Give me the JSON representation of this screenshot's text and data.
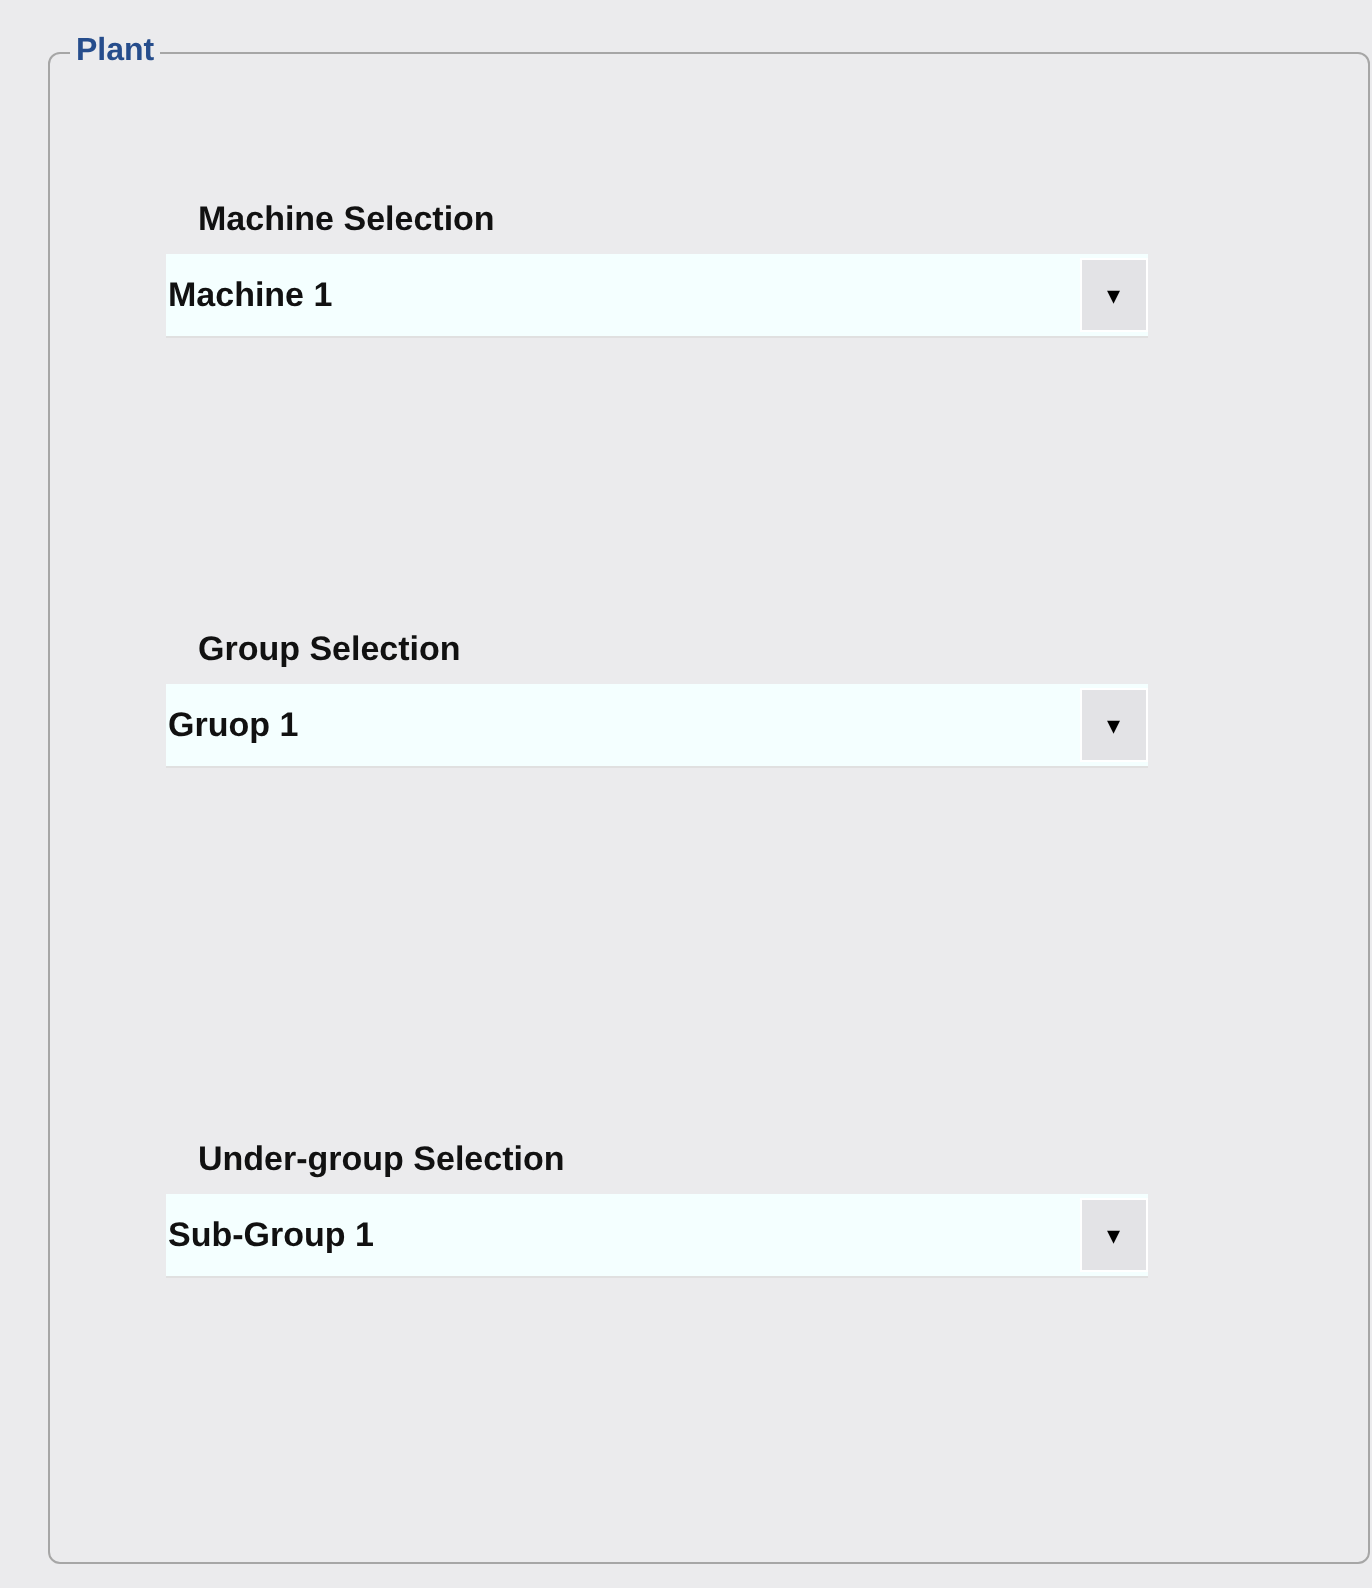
{
  "group_box": {
    "title": "Plant"
  },
  "selections": [
    {
      "label": "Machine Selection",
      "value": "Machine 1",
      "arrow": "▾"
    },
    {
      "label": "Group Selection",
      "value": "Gruop 1",
      "arrow": "▾"
    },
    {
      "label": "Under-group Selection",
      "value": "Sub-Group 1",
      "arrow": "▾"
    }
  ]
}
